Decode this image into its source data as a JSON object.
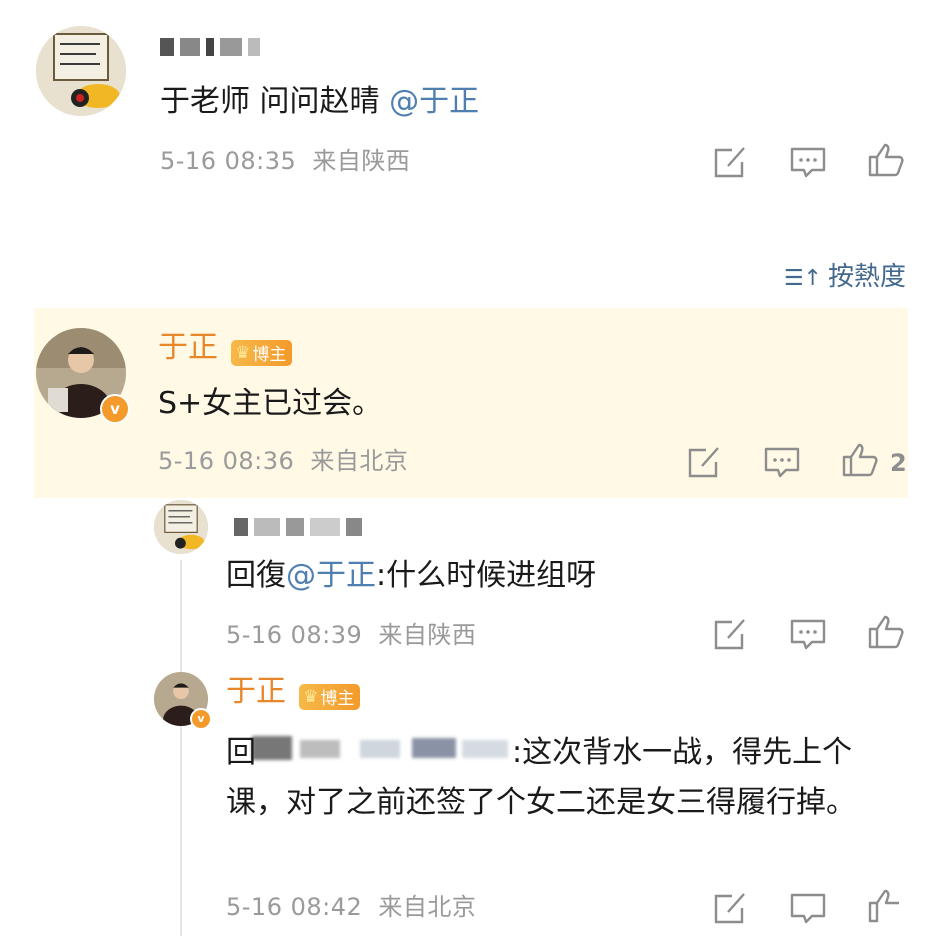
{
  "comment1": {
    "text_prefix": "于老师 问问赵晴 ",
    "mention": "@于正",
    "time": "5-16 08:35",
    "location": "来自陕西"
  },
  "sort": {
    "label": "按熱度",
    "icon": "sort-icon"
  },
  "comment2": {
    "author": "于正",
    "badge": "博主",
    "text": "S+女主已过会。",
    "time": "5-16 08:36",
    "location": "来自北京",
    "likes": "2"
  },
  "reply1": {
    "prefix": "回復",
    "mention": "@于正",
    "text": ":什么时候进组呀",
    "time": "5-16 08:39",
    "location": "来自陕西"
  },
  "reply2": {
    "author": "于正",
    "badge": "博主",
    "prefix": "回",
    "text": ":这次背水一战，得先上个课，对了之前还签了个女二还是女三得履行掉。",
    "time": "5-16 08:42",
    "location": "来自北京"
  },
  "icons": {
    "share": "share-icon",
    "comment": "comment-icon",
    "like": "like-icon",
    "verified": "verified-v-icon"
  },
  "colors": {
    "author": "#e8872a",
    "mention": "#4e7fb0",
    "meta": "#9a9a9a",
    "highlight": "#fff9e6"
  }
}
